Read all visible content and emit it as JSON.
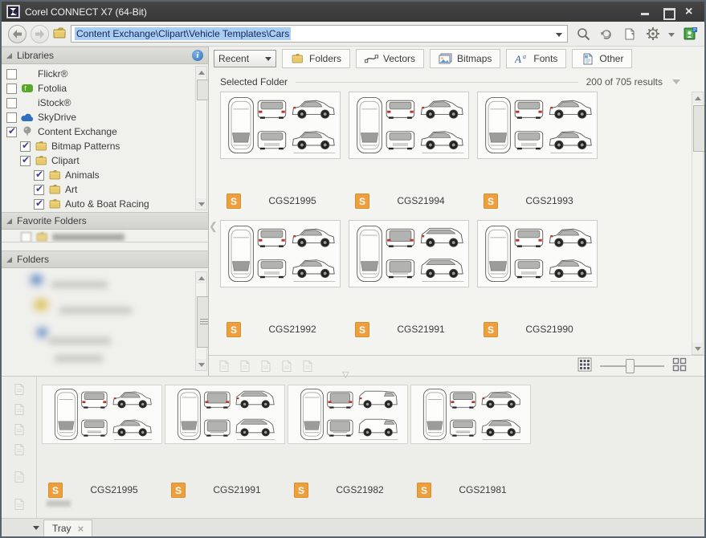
{
  "window": {
    "title": "Corel CONNECT X7 (64-Bit)"
  },
  "addressbar": {
    "path": "Content Exchange\\Clipart\\Vehicle Templates\\Cars"
  },
  "toolbar": {
    "recent": {
      "label": "Recent"
    },
    "filters": [
      {
        "label": "Folders",
        "icon": "folder-icon"
      },
      {
        "label": "Vectors",
        "icon": "vectors-curve-icon"
      },
      {
        "label": "Bitmaps",
        "icon": "bitmaps-image-icon"
      },
      {
        "label": "Fonts",
        "icon": "fonts-icon"
      },
      {
        "label": "Other",
        "icon": "other-file-icon"
      }
    ]
  },
  "sidebar": {
    "libraries": {
      "title": "Libraries",
      "items": [
        {
          "label": "Flickr®",
          "checked": false,
          "icon": "none",
          "indent": 0
        },
        {
          "label": "Fotolia",
          "checked": false,
          "icon": "fotolia-icon",
          "indent": 0
        },
        {
          "label": "iStock®",
          "checked": false,
          "icon": "none",
          "indent": 0
        },
        {
          "label": "SkyDrive",
          "checked": false,
          "icon": "skydrive-cloud-icon",
          "indent": 0
        },
        {
          "label": "Content Exchange",
          "checked": true,
          "icon": "content-exchange-pin-icon",
          "indent": 0
        },
        {
          "label": "Bitmap Patterns",
          "checked": true,
          "icon": "folder-icon",
          "indent": 1
        },
        {
          "label": "Clipart",
          "checked": true,
          "icon": "folder-icon",
          "indent": 1
        },
        {
          "label": "Animals",
          "checked": true,
          "icon": "folder-icon",
          "indent": 2
        },
        {
          "label": "Art",
          "checked": true,
          "icon": "folder-icon",
          "indent": 2
        },
        {
          "label": "Auto & Boat Racing",
          "checked": true,
          "icon": "folder-icon",
          "indent": 2
        }
      ]
    },
    "favorite_folders": {
      "title": "Favorite Folders"
    },
    "folders": {
      "title": "Folders"
    }
  },
  "main": {
    "header": {
      "title": "Selected Folder",
      "results": "200 of 705 results"
    },
    "badge_letter": "S",
    "items": [
      {
        "id": "CGS21995",
        "variant": "hatchback"
      },
      {
        "id": "CGS21994",
        "variant": "hatchback-alt"
      },
      {
        "id": "CGS21993",
        "variant": "hatchback"
      },
      {
        "id": "CGS21992",
        "variant": "hatchback-alt"
      },
      {
        "id": "CGS21991",
        "variant": "minivan"
      },
      {
        "id": "CGS21990",
        "variant": "hatchback"
      }
    ],
    "footer_icons": [
      "file-action-icon",
      "file-action-icon",
      "file-action-icon",
      "file-action-icon",
      "file-action-icon"
    ]
  },
  "tray": {
    "tab_label": "Tray",
    "side_icons": [
      "file-action-icon",
      "file-action-icon",
      "file-action-icon",
      "file-action-icon",
      "file-action-icon"
    ],
    "items": [
      {
        "id": "CGS21995",
        "variant": "hatchback",
        "watermark": true
      },
      {
        "id": "CGS21991",
        "variant": "minivan",
        "watermark": false
      },
      {
        "id": "CGS21982",
        "variant": "cargo-van",
        "watermark": false
      },
      {
        "id": "CGS21981",
        "variant": "wagon",
        "watermark": false
      }
    ]
  },
  "colors": {
    "badge_orange": "#ED9F3C",
    "selection_blue": "#A9CEF2",
    "titlebar_gray": "#3B3B3B",
    "folder_yellow": "#E6C766"
  }
}
